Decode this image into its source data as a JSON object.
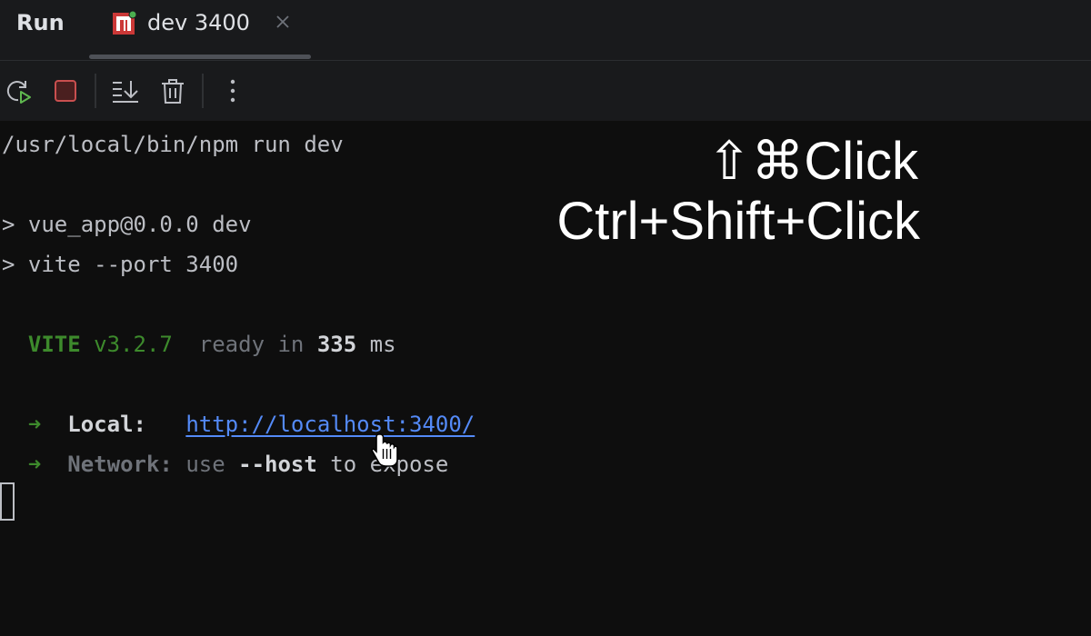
{
  "header": {
    "run_label": "Run",
    "tab": {
      "label": "dev 3400",
      "icon": "npm-icon",
      "status_color": "#4caf50"
    }
  },
  "toolbar": {
    "buttons": [
      "rerun-icon",
      "stop-icon",
      "scroll-to-end-icon",
      "clear-icon",
      "more-icon"
    ]
  },
  "console": {
    "lines": {
      "command": "/usr/local/bin/npm run dev",
      "script": "> vue_app@0.0.0 dev",
      "vite_cmd": "> vite --port 3400",
      "vite_name": "VITE",
      "vite_version": "v3.2.7",
      "ready_text": "ready in",
      "ready_ms": "335",
      "ready_unit": "ms",
      "arrow": "➜",
      "local_label": "Local:",
      "local_url": "http://localhost:3400/",
      "network_label": "Network:",
      "network_use": "use",
      "network_flag": "--host",
      "network_rest": "to expose"
    }
  },
  "overlay": {
    "mac_shortcut_keys": "⇧⌘",
    "mac_shortcut_action": "Click",
    "win_shortcut": "Ctrl+Shift+Click"
  },
  "colors": {
    "accent_link": "#548af7",
    "vite_green": "#3d8a2c",
    "background": "#0e0e0e",
    "toolbar_bg": "#191a1c",
    "stop_red": "#c94f4f"
  }
}
